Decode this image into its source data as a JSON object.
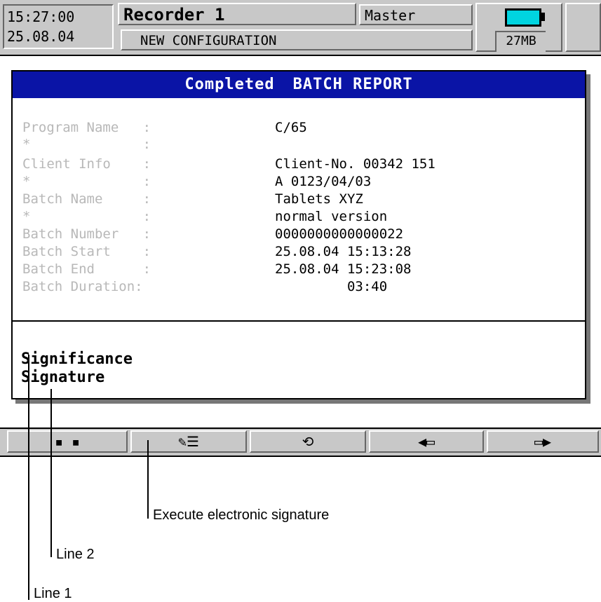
{
  "header": {
    "time": "15:27:00",
    "date": "25.08.04",
    "recorder": "Recorder 1",
    "role": "Master",
    "configuration": "NEW CONFIGURATION",
    "memory": "27MB",
    "battery_color": "#00d4e0"
  },
  "report": {
    "status": "Completed",
    "title": "BATCH REPORT",
    "rows": [
      {
        "label": "Program Name   :",
        "value": "C/65"
      },
      {
        "label": "*              :",
        "value": ""
      },
      {
        "label": "Client Info    :",
        "value": "Client-No. 00342 151"
      },
      {
        "label": "*              :",
        "value": "A 0123/04/03"
      },
      {
        "label": "Batch Name     :",
        "value": "Tablets XYZ"
      },
      {
        "label": "*              :",
        "value": "normal version"
      },
      {
        "label": "Batch Number   :",
        "value": "0000000000000022"
      },
      {
        "label": "Batch Start    :",
        "value": "25.08.04 15:13:28"
      },
      {
        "label": "Batch End      :",
        "value": "25.08.04 15:23:08"
      },
      {
        "label": "Batch Duration:",
        "value": "         03:40"
      }
    ],
    "signature_line1": "Significance",
    "signature_line2": "Signature"
  },
  "toolbar": {
    "buttons": [
      {
        "label": "▪ ▪",
        "icon": "more-icon"
      },
      {
        "label": "✎☰",
        "icon": "sign-document-icon"
      },
      {
        "label": "⟲",
        "icon": "undo-icon"
      },
      {
        "label": "◀▭",
        "icon": "scroll-left-icon"
      },
      {
        "label": "▭▶",
        "icon": "scroll-right-icon"
      }
    ]
  },
  "annotations": {
    "execute": "Execute electronic signature",
    "line2": "Line 2",
    "line1": "Line 1"
  }
}
